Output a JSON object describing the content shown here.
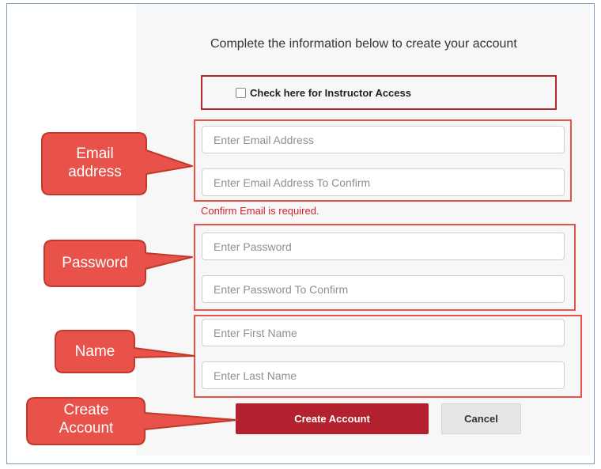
{
  "form": {
    "title": "Complete the information below to create your account",
    "instructor_label": "Check here for Instructor Access",
    "fields": {
      "email": "Enter Email Address",
      "email_confirm": "Enter Email Address To Confirm",
      "password": "Enter Password",
      "password_confirm": "Enter Password To Confirm",
      "first_name": "Enter First Name",
      "last_name": "Enter Last Name"
    },
    "error_email_confirm": "Confirm Email is required.",
    "create_label": "Create Account",
    "cancel_label": "Cancel"
  },
  "callouts": {
    "email": [
      "Email",
      "address"
    ],
    "password": "Password",
    "name": "Name",
    "create": [
      "Create",
      "Account"
    ]
  },
  "colors": {
    "brand_red": "#b3202e",
    "callout_fill": "#e8524a",
    "error_text": "#d2232a"
  }
}
